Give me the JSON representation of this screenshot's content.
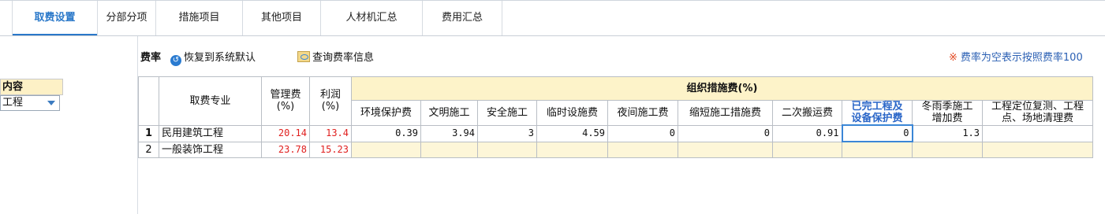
{
  "tabs": [
    {
      "label": "取费设置",
      "active": true
    },
    {
      "label": "分部分项",
      "active": false
    },
    {
      "label": "措施项目",
      "active": false
    },
    {
      "label": "其他项目",
      "active": false
    },
    {
      "label": "人材机汇总",
      "active": false
    },
    {
      "label": "费用汇总",
      "active": false
    }
  ],
  "left_panel": {
    "header": "内容",
    "select_value": "工程"
  },
  "toolbar": {
    "label": "费率",
    "restore_label": "恢复到系统默认",
    "query_label": "查询费率信息",
    "note_mark": "※",
    "note_text": "费率为空表示按照费率100"
  },
  "grid": {
    "headers": {
      "specialty": "取费专业",
      "mgmt_fee_line1": "管理费",
      "mgmt_fee_line2": "(%)",
      "profit_line1": "利润",
      "profit_line2": "(%)",
      "group": "组织措施费(%)",
      "sub": [
        {
          "line1": "环境保护费",
          "line2": ""
        },
        {
          "line1": "文明施工",
          "line2": ""
        },
        {
          "line1": "安全施工",
          "line2": ""
        },
        {
          "line1": "临时设施费",
          "line2": ""
        },
        {
          "line1": "夜间施工费",
          "line2": ""
        },
        {
          "line1": "缩短施工措施费",
          "line2": ""
        },
        {
          "line1": "二次搬运费",
          "line2": ""
        },
        {
          "line1": "已完工程及",
          "line2": "设备保护费"
        },
        {
          "line1": "冬雨季施工",
          "line2": "增加费"
        },
        {
          "line1": "工程定位复测、工程",
          "line2": "点、场地清理费"
        }
      ]
    },
    "rows": [
      {
        "num": "1",
        "specialty": "民用建筑工程",
        "mgmt_fee": "20.14",
        "profit": "13.4",
        "values": [
          "0.39",
          "3.94",
          "3",
          "4.59",
          "0",
          "0",
          "0.91",
          "0",
          "1.3",
          ""
        ]
      },
      {
        "num": "2",
        "specialty": "一般装饰工程",
        "mgmt_fee": "23.78",
        "profit": "15.23",
        "values": [
          "",
          "",
          "",
          "",
          "",
          "",
          "",
          "",
          "",
          ""
        ]
      }
    ]
  },
  "colors": {
    "accent": "#2a78c9",
    "header_yellow": "#fdf3c9",
    "red_value": "#e0201f",
    "note_blue": "#2a5fb3"
  }
}
